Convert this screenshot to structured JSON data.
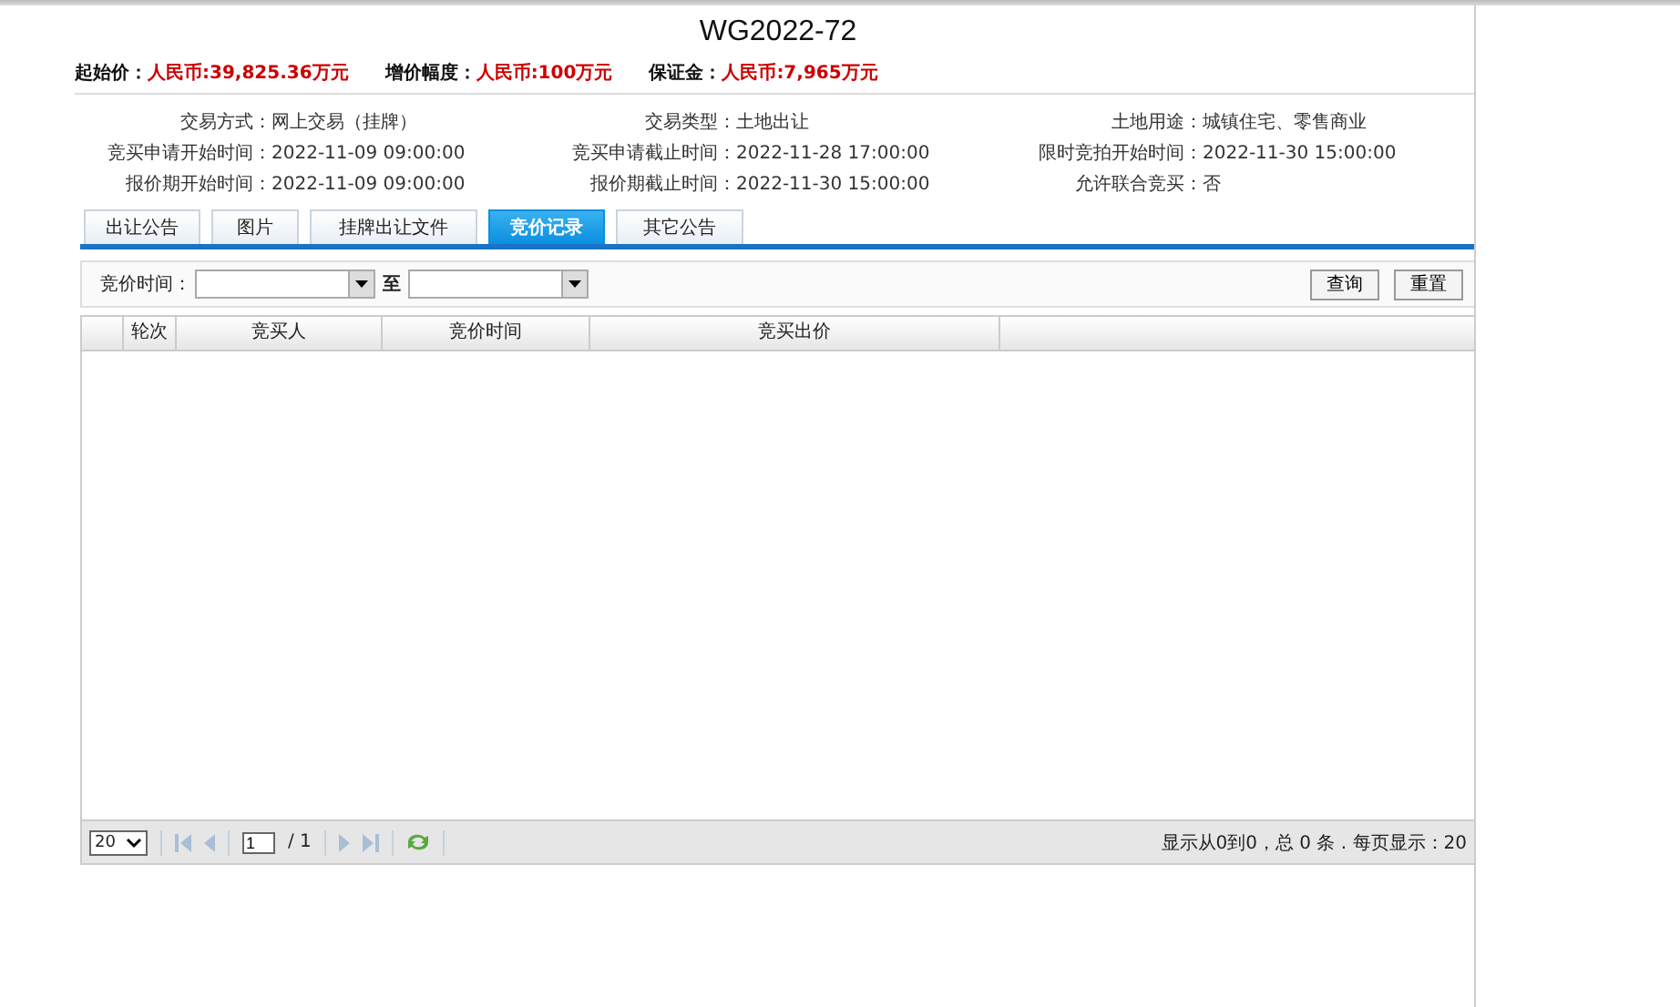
{
  "title": "WG2022-72",
  "prices": [
    {
      "label": "起始价：",
      "value": "人民币:39,825.36万元"
    },
    {
      "label": "增价幅度：",
      "value": "人民币:100万元"
    },
    {
      "label": "保证金：",
      "value": "人民币:7,965万元"
    }
  ],
  "info": [
    {
      "label": "交易方式：",
      "value": "网上交易（挂牌）"
    },
    {
      "label": "交易类型：",
      "value": "土地出让"
    },
    {
      "label": "土地用途：",
      "value": "城镇住宅、零售商业"
    },
    {
      "label": "竞买申请开始时间：",
      "value": "2022-11-09 09:00:00"
    },
    {
      "label": "竞买申请截止时间：",
      "value": "2022-11-28 17:00:00"
    },
    {
      "label": "限时竞拍开始时间：",
      "value": "2022-11-30 15:00:00"
    },
    {
      "label": "报价期开始时间：",
      "value": "2022-11-09 09:00:00"
    },
    {
      "label": "报价期截止时间：",
      "value": "2022-11-30 15:00:00"
    },
    {
      "label": "允许联合竞买：",
      "value": "否"
    }
  ],
  "tabs": [
    {
      "label": "出让公告",
      "selected": false
    },
    {
      "label": "图片",
      "selected": false
    },
    {
      "label": "挂牌出让文件",
      "selected": false
    },
    {
      "label": "竞价记录",
      "selected": true
    },
    {
      "label": "其它公告",
      "selected": false
    }
  ],
  "filter": {
    "label": "竞价时间：",
    "separator": "至",
    "buttons": [
      "查询",
      "重置"
    ]
  },
  "table": {
    "columns": [
      "轮次",
      "竞买人",
      "竞价时间",
      "竞买出价"
    ]
  },
  "pager": {
    "page_size": "20",
    "page": "1",
    "total_pages": "/ 1",
    "summary": "显示从0到0，总 0 条 . 每页显示：20"
  }
}
